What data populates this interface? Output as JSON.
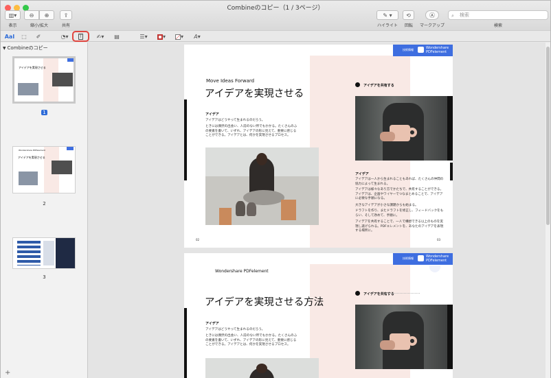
{
  "window": {
    "title": "Combineのコピー（1 / 3ページ）"
  },
  "toolbar": {
    "view_label": "表示",
    "zoom_label": "縮小/拡大",
    "share_label": "共有",
    "highlight_label": "ハイライト",
    "rotate_label": "回転",
    "markup_label": "マークアップ",
    "search_label": "検索",
    "search_placeholder": "検索"
  },
  "markup": {
    "text_style": "AaI"
  },
  "sidebar": {
    "header": "Combineのコピー",
    "pages": [
      {
        "label": "1",
        "selected": true
      },
      {
        "label": "2",
        "selected": false
      },
      {
        "label": "3",
        "selected": false
      }
    ],
    "add_label": "+"
  },
  "doc": {
    "page1": {
      "badge_small": "技術情報",
      "badge_brand": "Wondershare PDFelement",
      "tagline": "Move Ideas Forward",
      "title": "アイデアを実現させる",
      "section_label": "アイデア",
      "para1": "アイデアはどうやって生まれるのだろう。",
      "para2": "ときには偶然の出会い、人前のない所でもかかる。たくさんのふの要素を書いて、いずれ、アイデアの形に見えて、重要に感じることができる。アイデアとは、何かを実現させるプロセス。",
      "right_heading": "アイデアを共有する",
      "right_label": "アイデア",
      "rpara1": "アイデアは一人から生まれることもあれば、たくさんの仲間の協力によって生まれる。",
      "rpara2": "アイデアは様々なあり方でかたちで、共有することができる。アイデアは、企画やワイヤーでつなまとめることで、アイデアに必要な手順になる。",
      "rpara3": "大きなアイデアが小さな課題からも始まる。",
      "rpara4": "ドラフトを作り、またドラフトを修正し、フィードバックをもらい、そして改めて、手順に。",
      "rpara5": "アイデアを共有することで、一人で構想できる以上のものを実現し遂げられる。PDFエレメントを、あなたのアイデアを表現する場所に。",
      "footer_left": "02",
      "footer_right": "03"
    },
    "page2": {
      "badge_small": "技術情報",
      "badge_brand": "Wondershare PDFelement",
      "brand": "Wondershare PDFelement",
      "title": "アイデアを実現させる方法",
      "right_heading": "アイデアを共有する",
      "section_label": "アイデア",
      "para1": "アイデアはどうやって生まれるのだろう。",
      "para2": "ときには偶然の出会い、人前のない所でもかかる。たくさんのふの要素を書いて、いずれ、アイデアの形に見えて、重要に感じることができる。アイデアとは、何かを実現させるプロセス。"
    }
  },
  "thumbs": {
    "t1_title": "アイデアを実現させる",
    "t2_title": "アイデアを実現させる",
    "t2_brand": "Wondershare PDFelement"
  },
  "colors": {
    "accent": "#2e6cd8",
    "brand": "#3e6ee0",
    "pink": "#f9e9e5",
    "highlight_ring": "#e0453f"
  }
}
